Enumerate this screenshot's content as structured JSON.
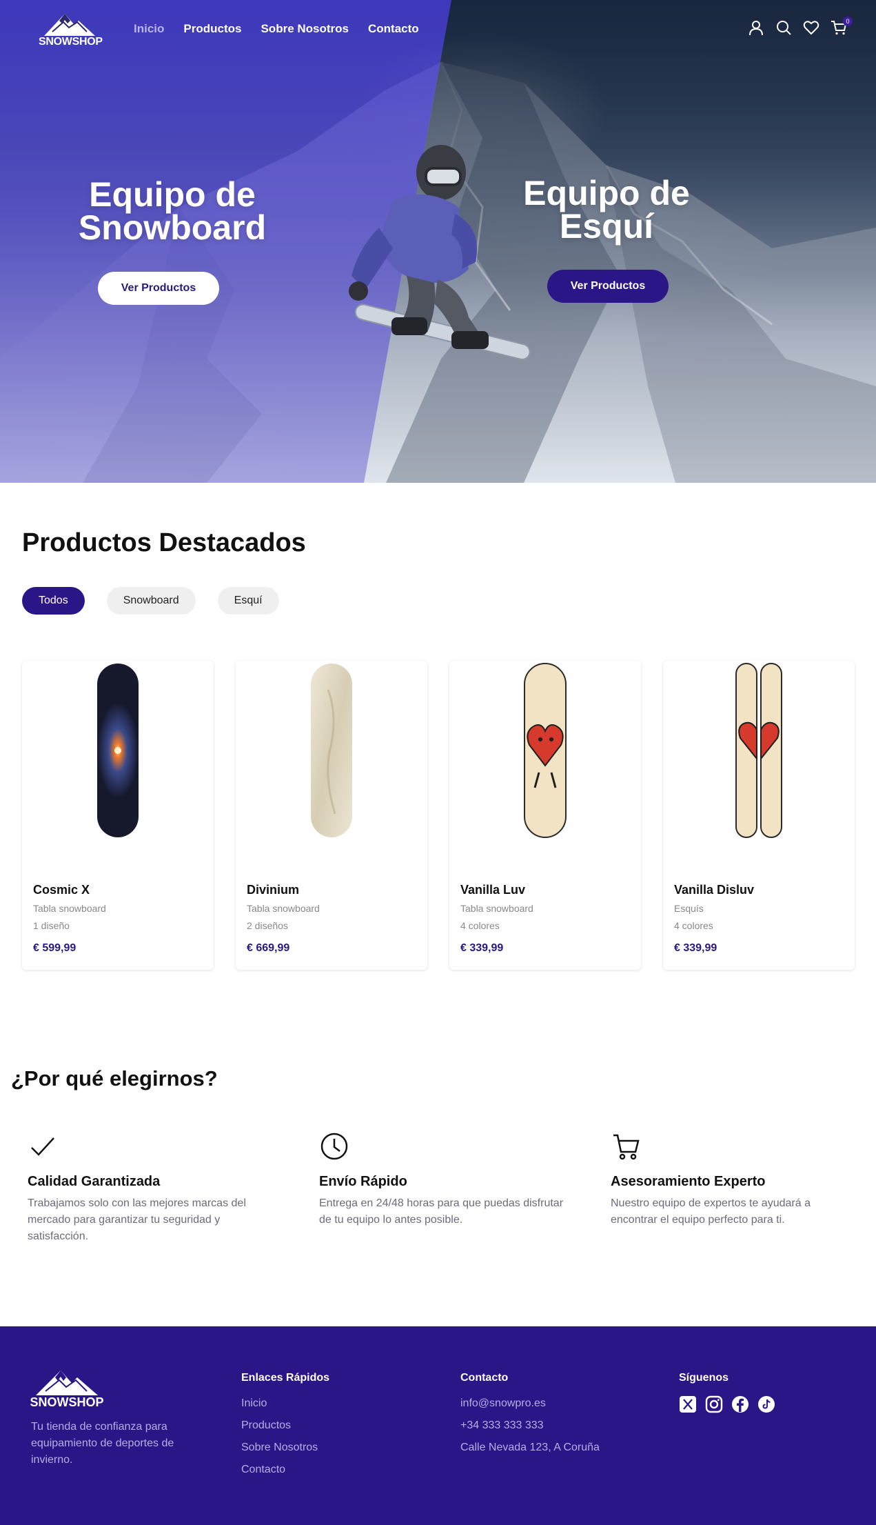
{
  "brand": {
    "name": "SNOWSHOP"
  },
  "nav": {
    "links": [
      "Inicio",
      "Productos",
      "Sobre Nosotros",
      "Contacto"
    ],
    "active": "Inicio",
    "cart_count": "0",
    "icons": [
      "user-icon",
      "search-icon",
      "heart-icon",
      "cart-icon"
    ]
  },
  "hero": {
    "left": {
      "title_line1": "Equipo de",
      "title_line2": "Snowboard",
      "button": "Ver Productos"
    },
    "right": {
      "title_line1": "Equipo de",
      "title_line2": "Esquí",
      "button": "Ver Productos"
    }
  },
  "featured": {
    "title": "Productos Destacados",
    "filters": [
      "Todos",
      "Snowboard",
      "Esquí"
    ],
    "active_filter": "Todos",
    "products": [
      {
        "name": "Cosmic X",
        "category": "Tabla snowboard",
        "variants": "1 diseño",
        "price": "€ 599,99"
      },
      {
        "name": "Divinium",
        "category": "Tabla snowboard",
        "variants": "2 diseños",
        "price": "€ 669,99"
      },
      {
        "name": "Vanilla Luv",
        "category": "Tabla snowboard",
        "variants": "4 colores",
        "price": "€ 339,99"
      },
      {
        "name": "Vanilla Disluv",
        "category": "Esquís",
        "variants": "4 colores",
        "price": "€ 339,99"
      }
    ]
  },
  "why": {
    "title": "¿Por qué elegirnos?",
    "items": [
      {
        "icon": "check-icon",
        "title": "Calidad Garantizada",
        "text": "Trabajamos solo con las mejores marcas del mercado para garantizar tu seguridad y satisfacción."
      },
      {
        "icon": "clock-icon",
        "title": "Envío Rápido",
        "text": "Entrega en 24/48 horas para que puedas disfrutar de tu equipo lo antes posible."
      },
      {
        "icon": "cart-icon",
        "title": "Asesoramiento Experto",
        "text": "Nuestro equipo de expertos te ayudará a encontrar el equipo perfecto para ti."
      }
    ]
  },
  "footer": {
    "brand": "SNOWSHOP",
    "tagline": "Tu tienda de confianza para equipamiento de deportes de invierno.",
    "quick_links": {
      "title": "Enlaces Rápidos",
      "items": [
        "Inicio",
        "Productos",
        "Sobre Nosotros",
        "Contacto"
      ]
    },
    "contact": {
      "title": "Contacto",
      "email": "info@snowpro.es",
      "phone": "+34 333 333 333",
      "address": "Calle Nevada 123, A Coruña"
    },
    "social": {
      "title": "Síguenos",
      "icons": [
        "x-icon",
        "instagram-icon",
        "facebook-icon",
        "tiktok-icon"
      ]
    }
  },
  "colors": {
    "primary": "#2b1688",
    "hero_left_tint": "#4038c4",
    "footer_text": "#b6aee6",
    "muted_text": "#6b6b7b"
  }
}
